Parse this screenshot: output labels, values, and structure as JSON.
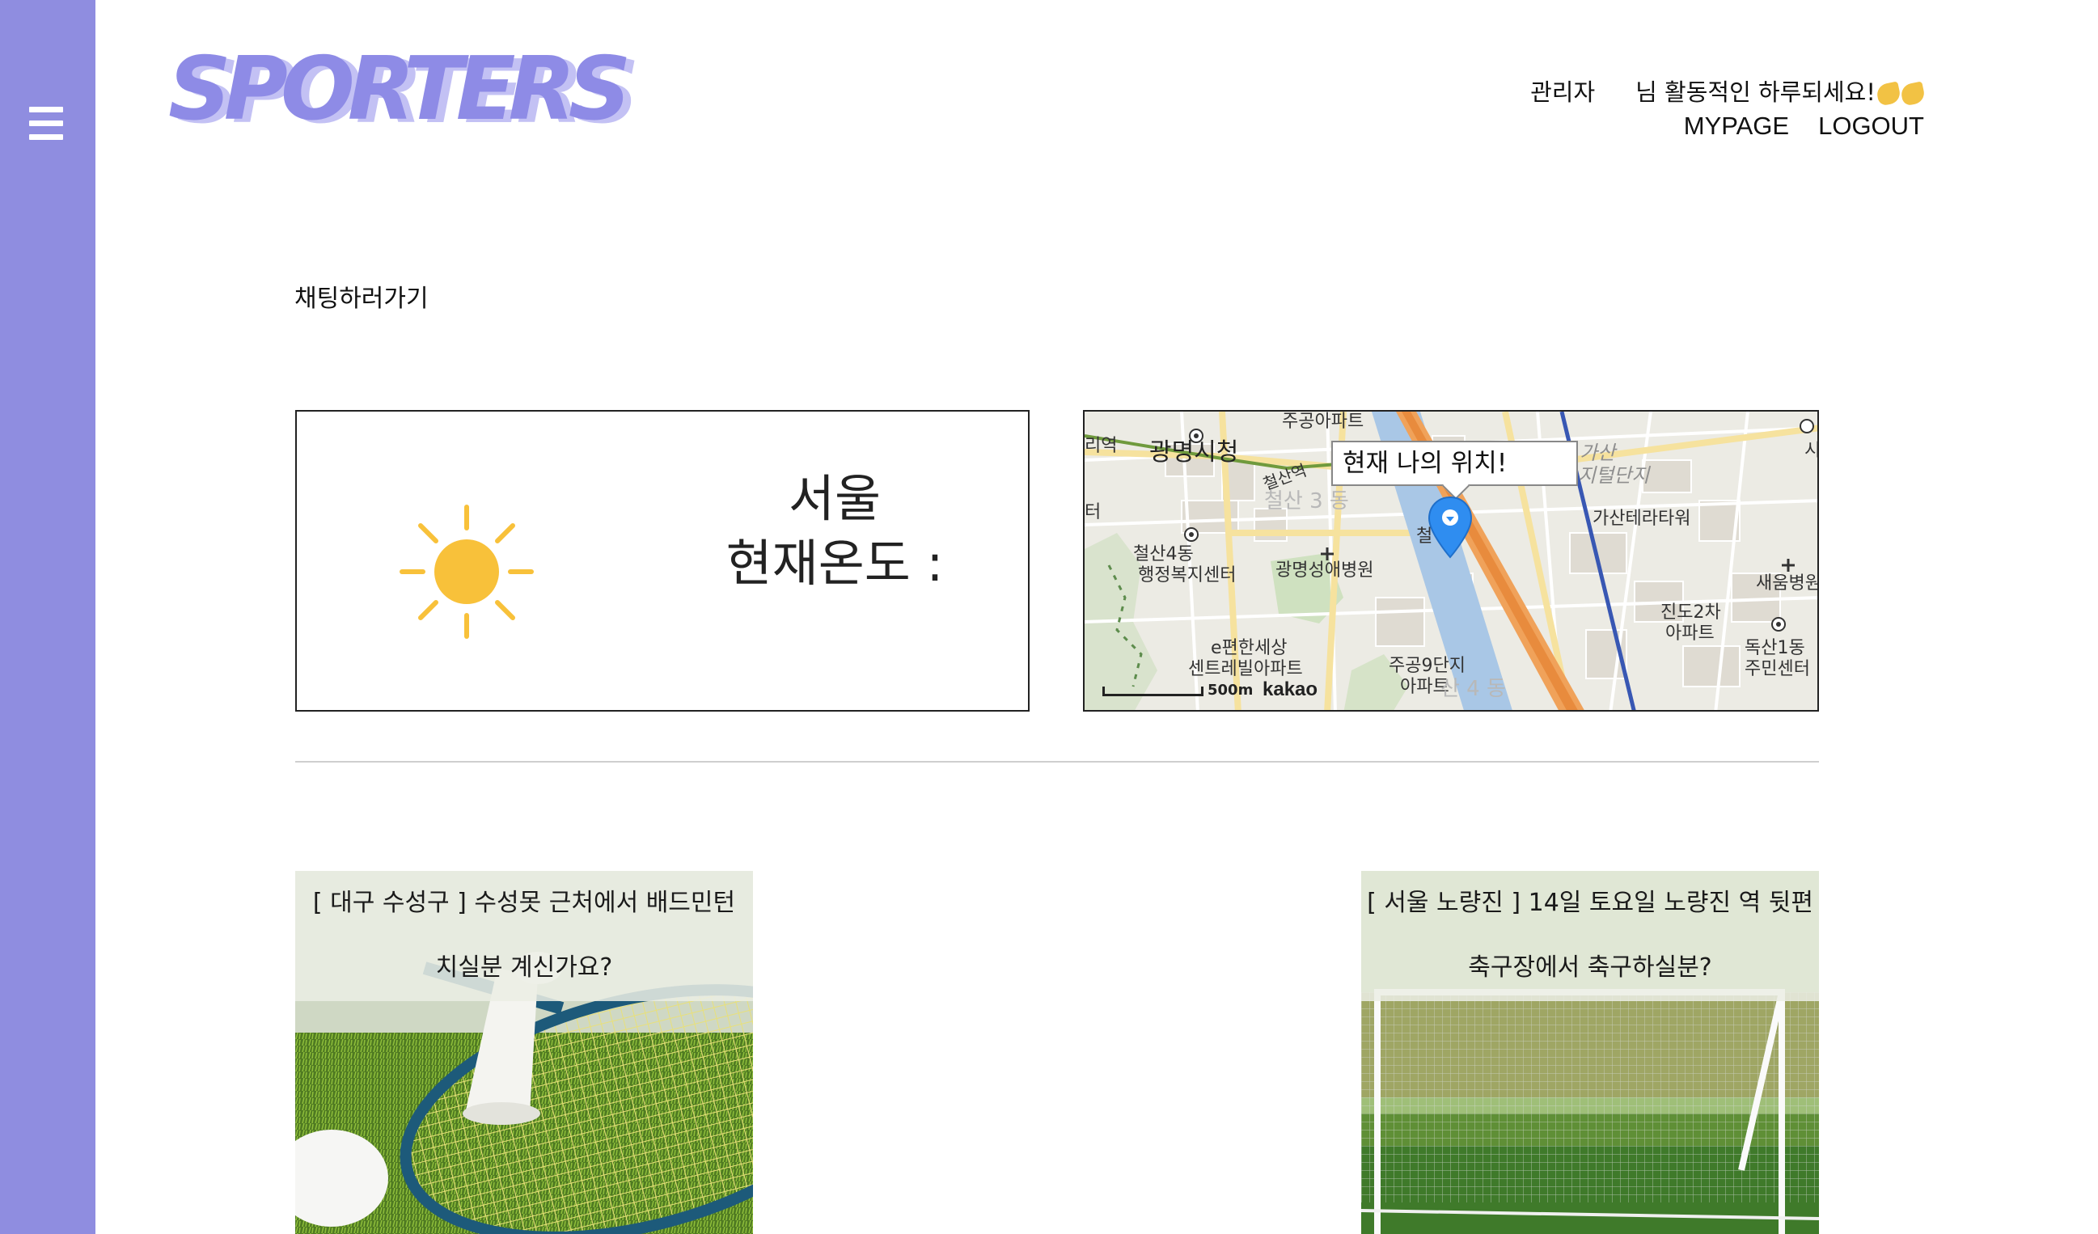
{
  "sidebar": {
    "menu_icon": "hamburger-menu-icon"
  },
  "header": {
    "logo_text": "SPORTERS",
    "user_name": "관리자",
    "greeting": "님 활동적인 하루되세요!",
    "greeting_emoji": "flexed-biceps-emoji",
    "links": {
      "mypage": "MYPAGE",
      "logout": "LOGOUT"
    }
  },
  "main": {
    "chat_link": "채팅하러가기",
    "weather": {
      "icon": "sun-icon",
      "city": "서울",
      "temp_label": "현재온도 :"
    },
    "map": {
      "tooltip": "현재 나의 위치!",
      "marker_icon": "location-pin-icon",
      "labels": {
        "apartment_top": "주공아파트",
        "station_edge": "리역",
        "city_hall": "광명시청",
        "cheolsan_station": "철산역",
        "cheolsan3dong": "철산 3 동",
        "te": "터",
        "cheolsan4dong_1": "철산4동",
        "cheolsan4dong_2": "행정복지센터",
        "hospital": "광명성애병원",
        "cheol_partial": "철",
        "eapt_1": "e편한세상",
        "eapt_2": "센트레빌아파트",
        "jugong9_1": "주공9단지",
        "jugong9_2": "아파트",
        "dong4": "산 4 동",
        "gasan_1": "가산",
        "gasan_2": "지털단지",
        "gasan_terra": "가산테라타워",
        "jindo_1": "진도2차",
        "jindo_2": "아파트",
        "saeum": "새움병원",
        "doksan_1": "독산1동",
        "doksan_2": "주민센터",
        "si": "시"
      },
      "scale": "500m",
      "brand": "kakao"
    },
    "posts": [
      {
        "line1": "[ 대구 수성구 ] 수성못 근처에서 배드민턴",
        "line2": "치실분 계신가요?",
        "image": "badminton-photo"
      },
      {
        "line1": "[ 서울 노량진 ] 14일 토요일 노량진 역 뒷편",
        "line2": "축구장에서 축구하실분?",
        "image": "soccer-goal-photo"
      }
    ]
  },
  "colors": {
    "sidebar": "#8f8de0",
    "logo": "#8e8be6",
    "logo_shadow": "#c3c1f4",
    "sun": "#f8c13a"
  }
}
